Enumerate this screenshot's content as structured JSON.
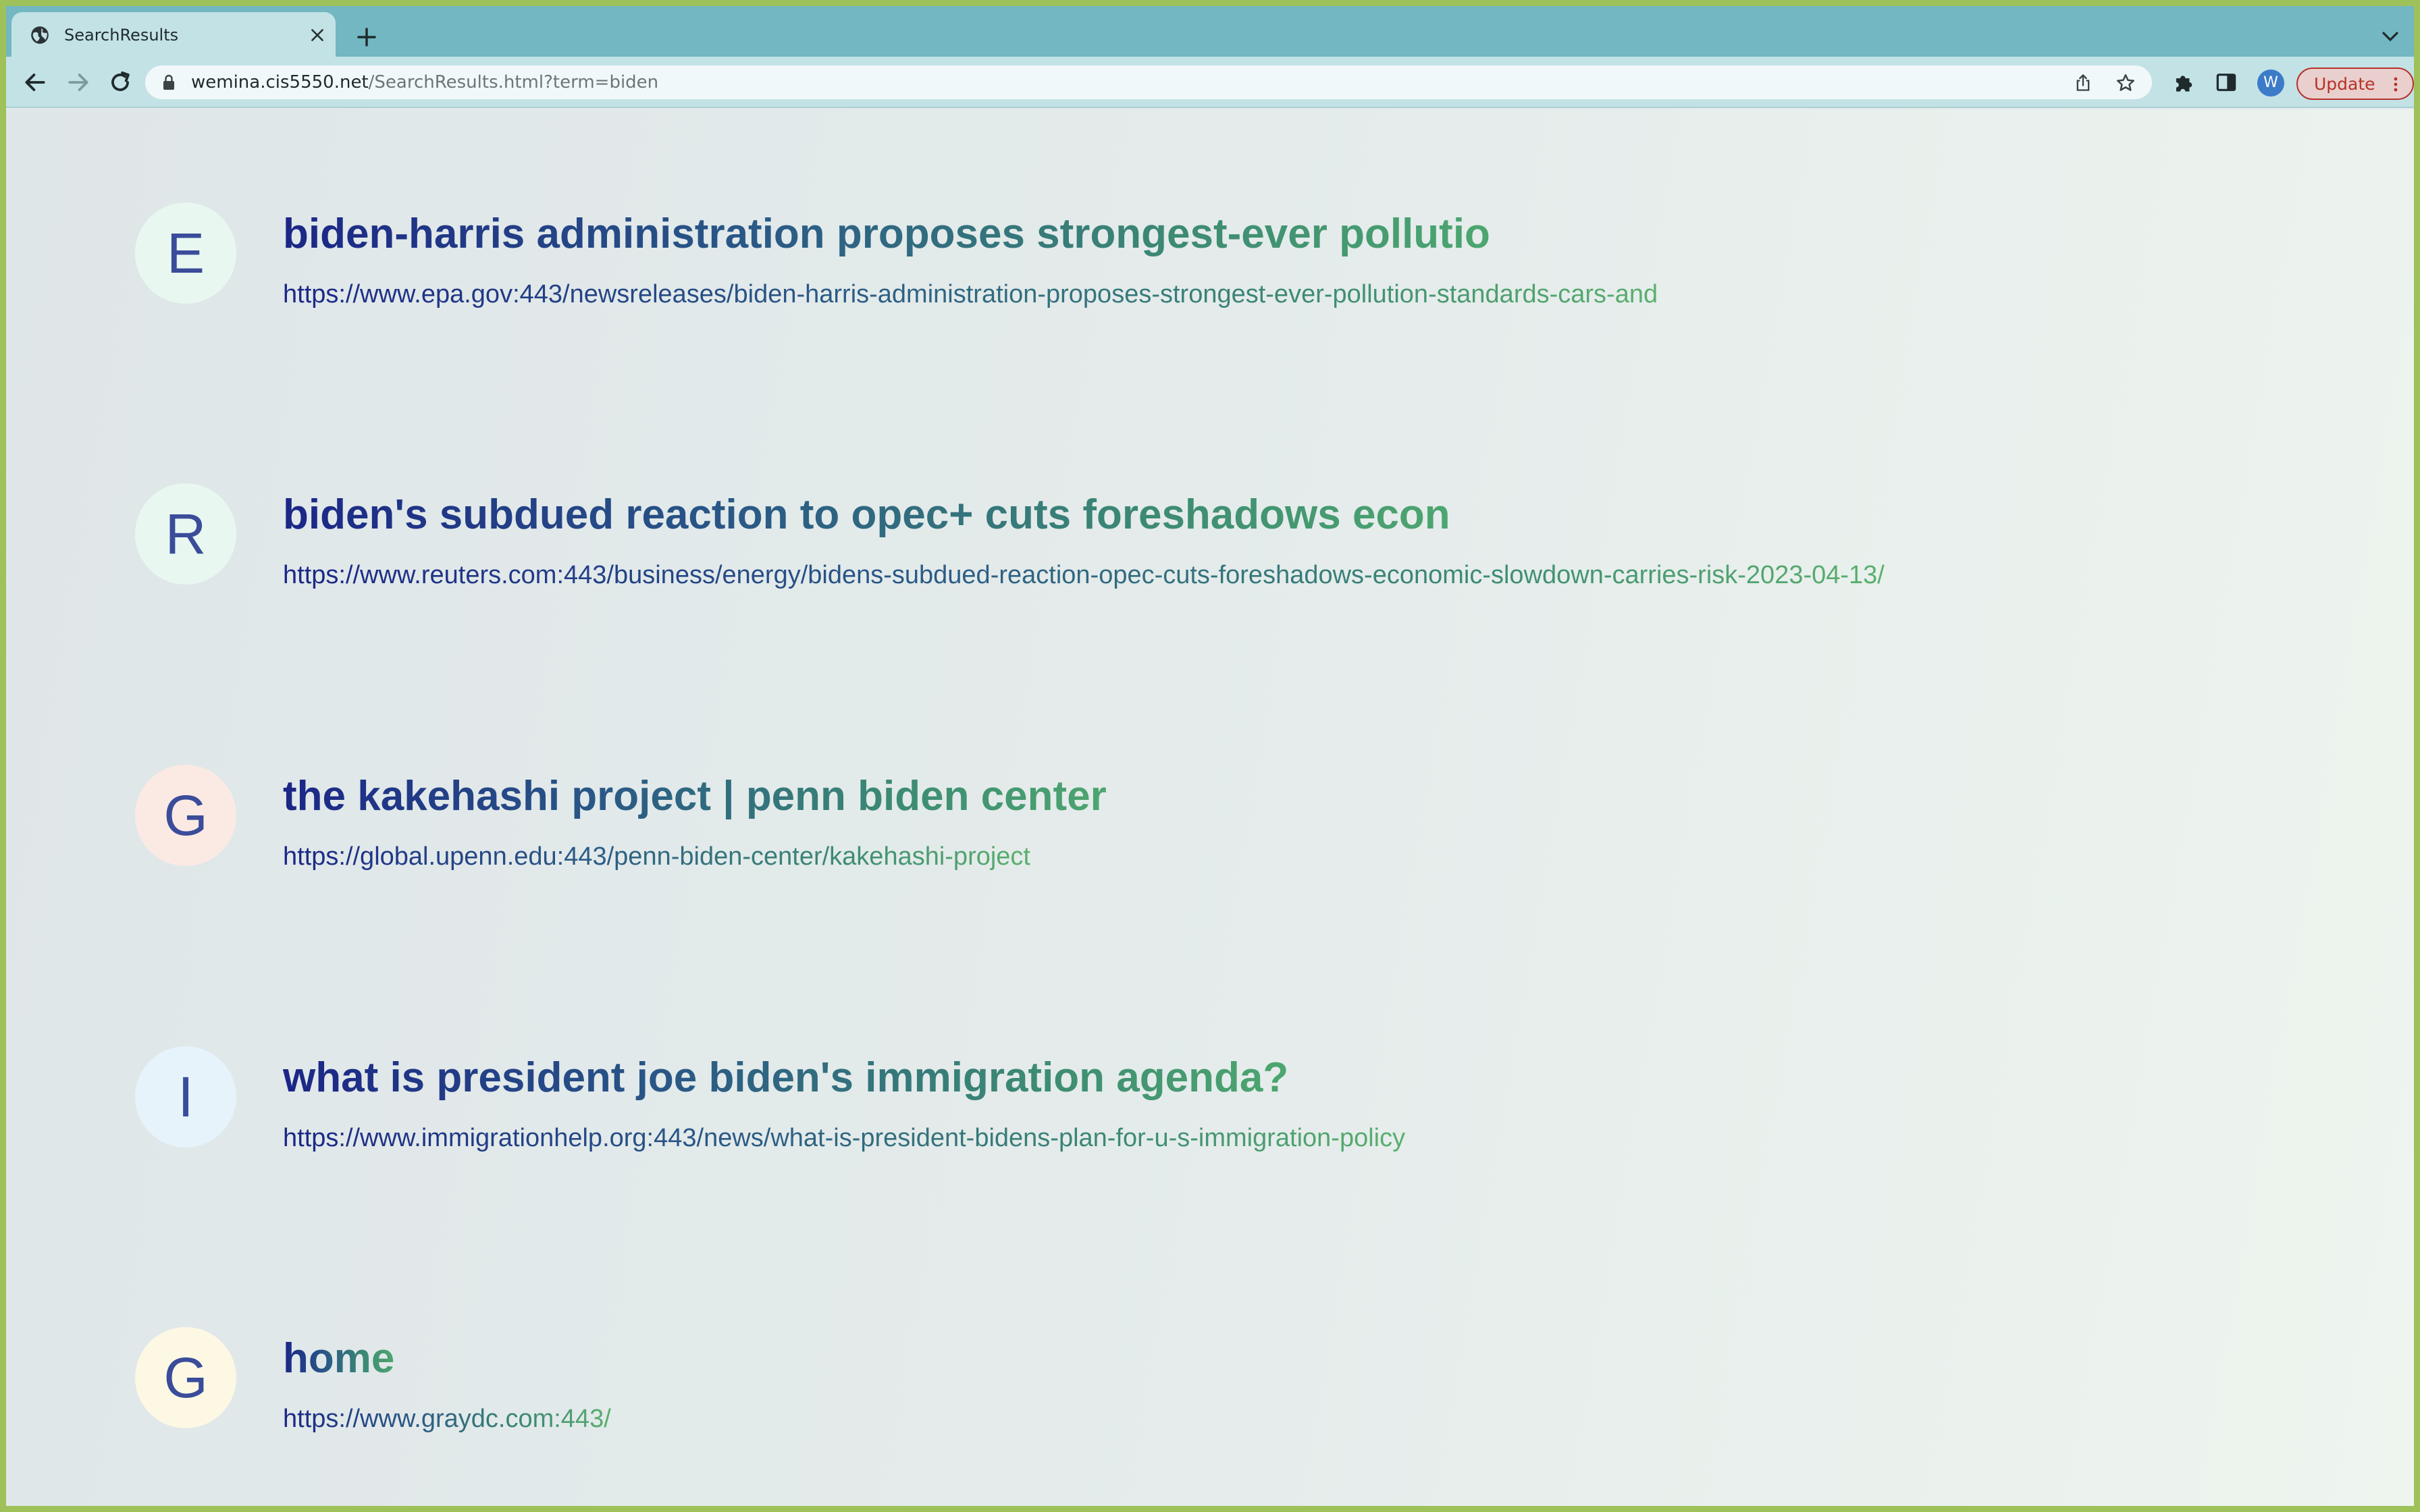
{
  "browser": {
    "tab_title": "SearchResults",
    "url_host": "wemina.cis5550.net",
    "url_path": "/SearchResults.html?term=biden",
    "avatar_letter": "W",
    "update_label": "Update"
  },
  "colors": {
    "frame": "#9fc15a",
    "tabstrip": "#72b7c1",
    "toolbar": "#c3e2e6",
    "title_start": "#1b2687",
    "title_end": "#4da66f",
    "update_red": "#b5322a"
  },
  "results": [
    {
      "letter": "E",
      "circle_color": "#e8f8f1",
      "title": "biden-harris administration proposes strongest-ever pollutio",
      "url": "https://www.epa.gov:443/newsreleases/biden-harris-administration-proposes-strongest-ever-pollution-standards-cars-and"
    },
    {
      "letter": "R",
      "circle_color": "#e8f8f1",
      "title": "biden's subdued reaction to opec+ cuts foreshadows econ",
      "url": "https://www.reuters.com:443/business/energy/bidens-subdued-reaction-opec-cuts-foreshadows-economic-slowdown-carries-risk-2023-04-13/"
    },
    {
      "letter": "G",
      "circle_color": "#fbeae4",
      "title": "the kakehashi project | penn biden center",
      "url": "https://global.upenn.edu:443/penn-biden-center/kakehashi-project"
    },
    {
      "letter": "I",
      "circle_color": "#e6f3fb",
      "title": "what is president joe biden's immigration agenda?",
      "url": "https://www.immigrationhelp.org:443/news/what-is-president-bidens-plan-for-u-s-immigration-policy"
    },
    {
      "letter": "G",
      "circle_color": "#fdf8e4",
      "title": "home",
      "url": "https://www.graydc.com:443/"
    }
  ]
}
